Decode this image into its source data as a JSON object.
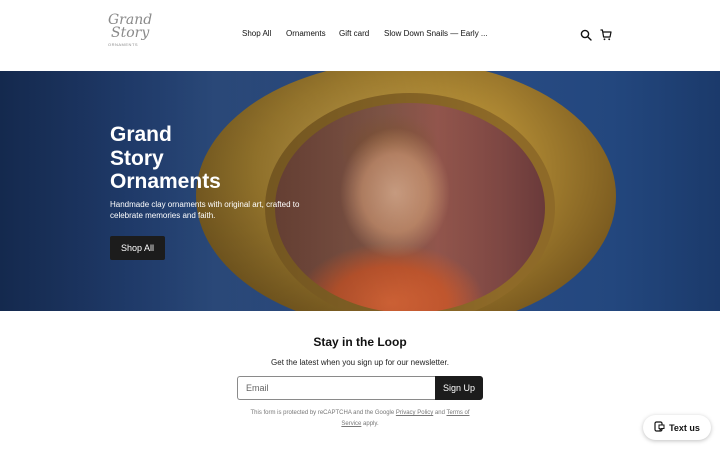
{
  "header": {
    "logo": {
      "line1": "Grand",
      "line2": "Story",
      "line3": "ORNAMENTS"
    },
    "nav": [
      "Shop All",
      "Ornaments",
      "Gift card",
      "Slow Down Snails — Early ..."
    ],
    "icons": {
      "search": "search-icon",
      "cart": "cart-icon"
    }
  },
  "hero": {
    "title_lines": [
      "Grand",
      "Story",
      "Ornaments"
    ],
    "subtitle": "Handmade clay ornaments with original art, crafted to celebrate memories and faith.",
    "button": "Shop All"
  },
  "newsletter": {
    "title": "Stay in the Loop",
    "subtitle": "Get the latest when you sign up for our newsletter.",
    "email_placeholder": "Email",
    "button": "Sign Up",
    "legal_prefix": "This form is protected by reCAPTCHA and the Google",
    "privacy_link": "Privacy Policy",
    "and": "and",
    "terms_link": "Terms of Service",
    "legal_suffix": "apply."
  },
  "chat_widget": {
    "label": "Text us",
    "icon": "message-icon"
  },
  "colors": {
    "button_bg": "#1c1c1c",
    "hero_blue": "#2a4f8f",
    "frame_gold": "#b08a34"
  }
}
